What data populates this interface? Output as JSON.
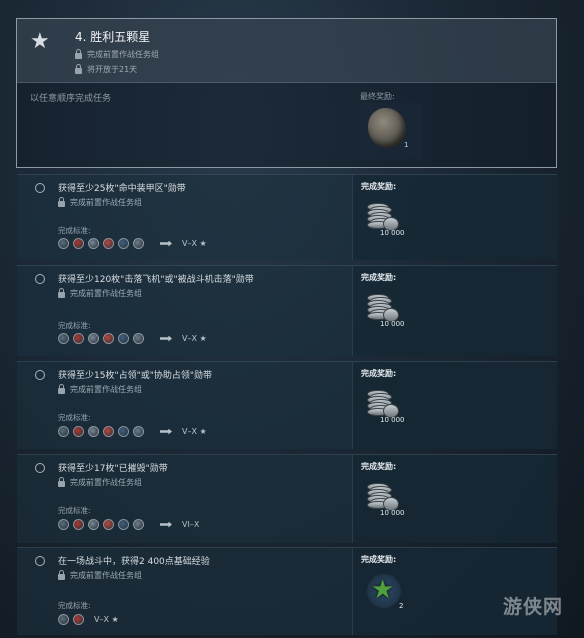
{
  "header": {
    "star_icon": "star-icon",
    "title": "4. 胜利五颗星",
    "lock_line_1": "完成前置作战任务组",
    "lock_line_2": "将开放于21天",
    "subtitle": "以任意顺序完成任务",
    "reward_label": "最终奖励:",
    "container_count": "1"
  },
  "tasks": [
    {
      "title": "获得至少25枚\"命中装甲区\"勋带",
      "lock": "完成前置作战任务组",
      "criteria_label": "完成标准:",
      "tier": "V–X ★",
      "reward_label": "完成奖励:",
      "reward_value": "10 000"
    },
    {
      "title": "获得至少120枚\"击落飞机\"或\"被战斗机击落\"勋带",
      "lock": "完成前置作战任务组",
      "criteria_label": "完成标准:",
      "tier": "V–X ★",
      "reward_label": "完成奖励:",
      "reward_value": "10 000"
    },
    {
      "title": "获得至少15枚\"占领\"或\"协助占领\"勋带",
      "lock": "完成前置作战任务组",
      "criteria_label": "完成标准:",
      "tier": "V–X ★",
      "reward_label": "完成奖励:",
      "reward_value": "10 000"
    },
    {
      "title": "获得至少17枚\"已摧毁\"勋带",
      "lock": "完成前置作战任务组",
      "criteria_label": "完成标准:",
      "tier": "VI–X",
      "reward_label": "完成奖励:",
      "reward_value": "10 000"
    },
    {
      "title": "在一场战斗中，获得2 400点基础经验",
      "lock": "完成前置作战任务组",
      "criteria_label": "完成标准:",
      "tier": "V–X ★",
      "reward_label": "完成奖励:",
      "reward_value": "2"
    }
  ],
  "colors": {
    "flags": [
      "#5b6f7a",
      "#b2372d",
      "#7a8a96",
      "#c0463b",
      "#3e5f7f",
      "#6e7f8c"
    ]
  },
  "watermark": "游侠网"
}
